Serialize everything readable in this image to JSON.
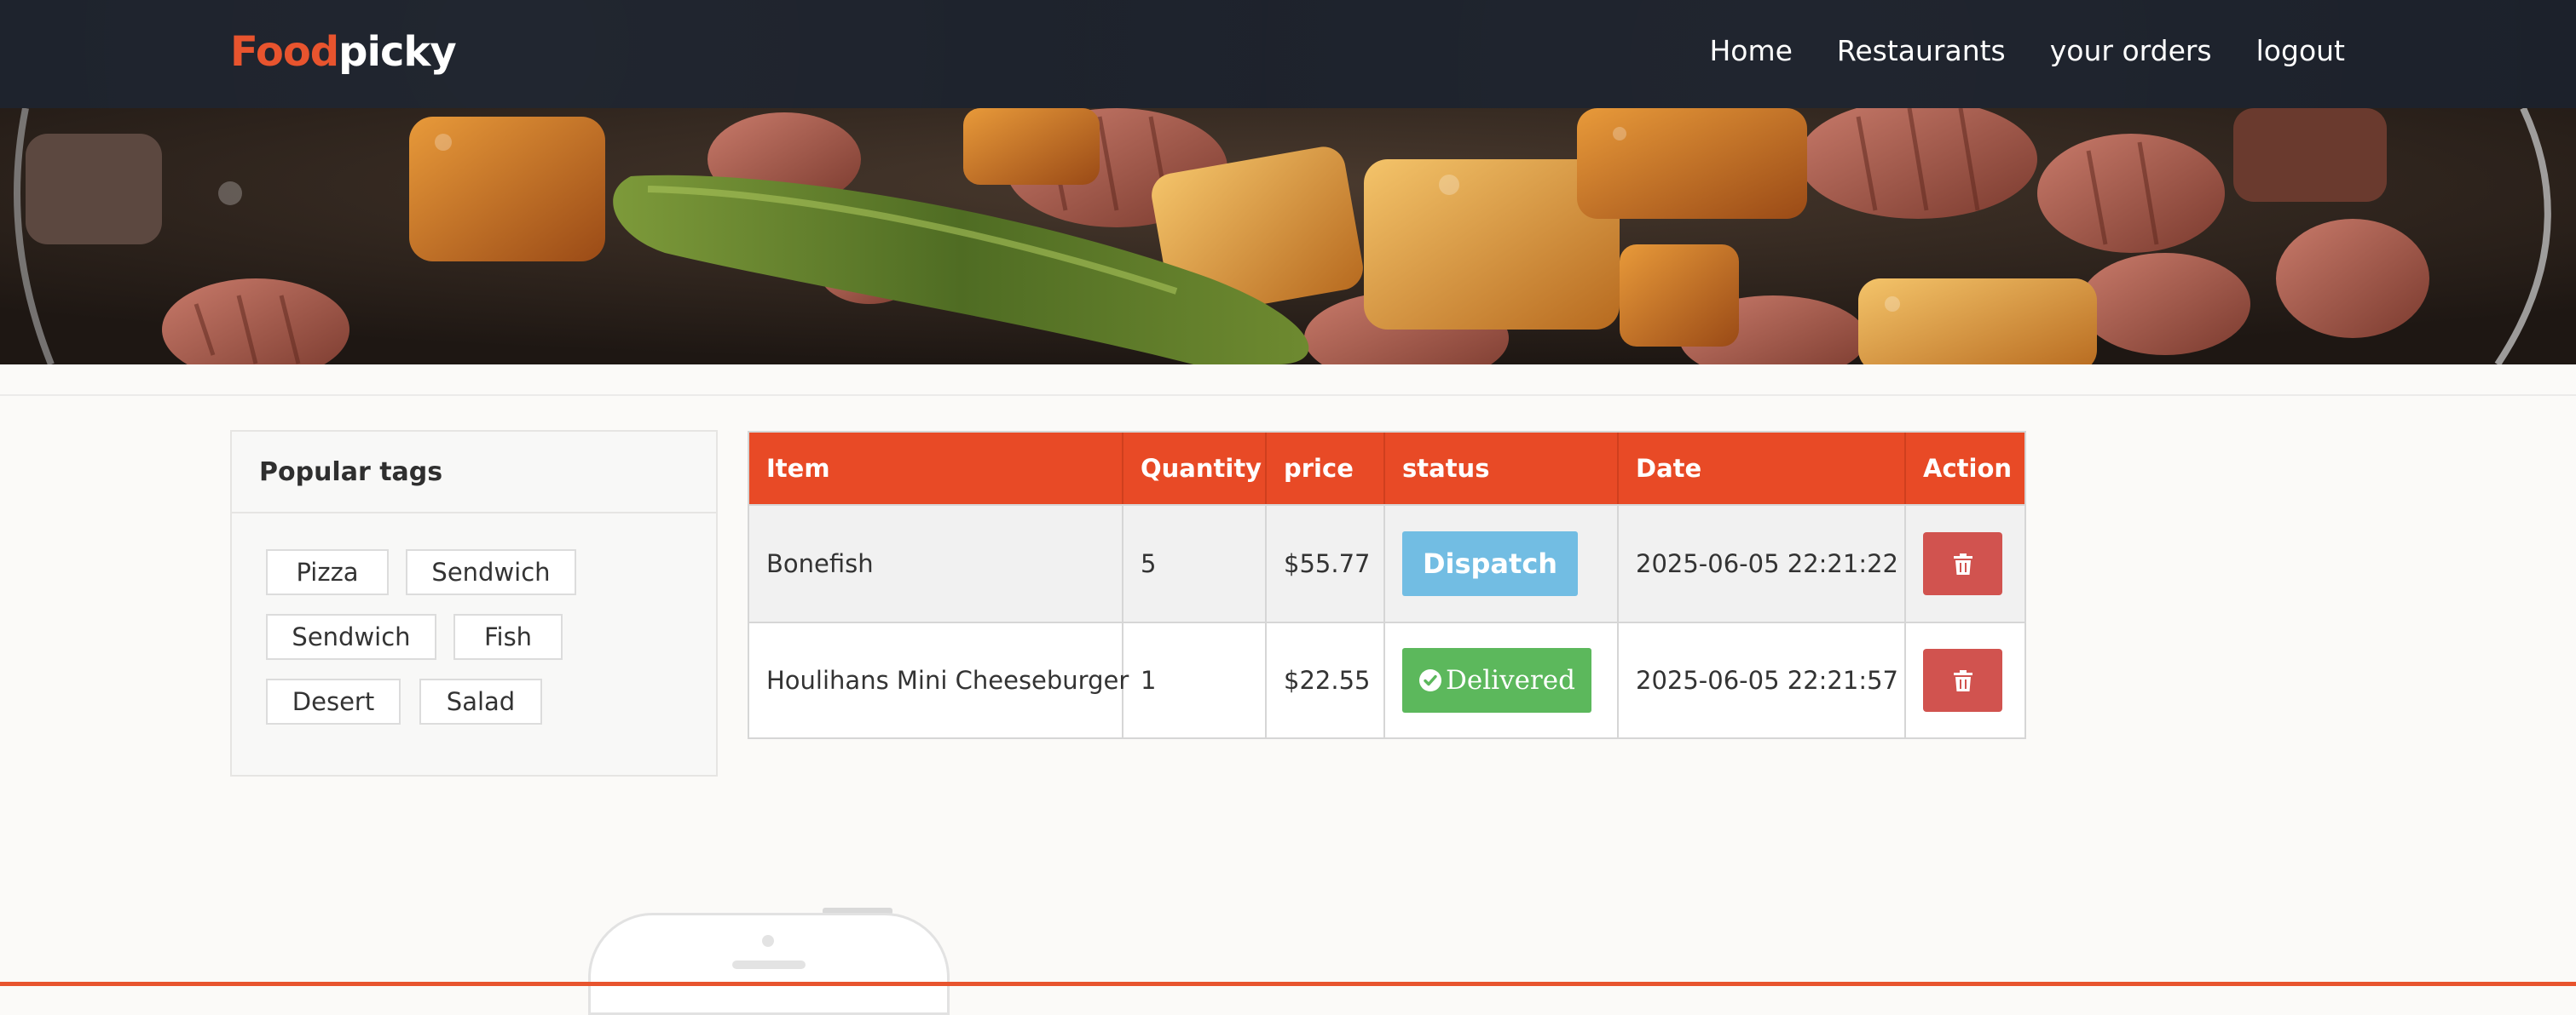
{
  "brand": {
    "logo_part1": "Food",
    "logo_part2": "picky",
    "accent_color": "#e8542e"
  },
  "nav": {
    "items": [
      {
        "label": "Home"
      },
      {
        "label": "Restaurants"
      },
      {
        "label": "your orders"
      },
      {
        "label": "logout"
      }
    ]
  },
  "hero": {
    "image": "food-hero-photo"
  },
  "sidebar": {
    "title": "Popular tags",
    "tags": [
      "Pizza",
      "Sendwich",
      "Sendwich",
      "Fish",
      "Desert",
      "Salad"
    ]
  },
  "orders": {
    "headers": {
      "item": "Item",
      "quantity": "Quantity",
      "price": "price",
      "status": "status",
      "date": "Date",
      "action": "Action"
    },
    "rows": [
      {
        "item": "Bonefish",
        "quantity": "5",
        "price": "$55.77",
        "status": "Dispatch",
        "status_color": "#72bde3",
        "date": "2025-06-05 22:21:22",
        "action_icon": "trash-icon"
      },
      {
        "item": "Houlihans Mini Cheeseburger",
        "quantity": "1",
        "price": "$22.55",
        "status": "Delivered",
        "status_icon": "check-circle-icon",
        "status_color": "#5cb85c",
        "date": "2025-06-05 22:21:57",
        "action_icon": "trash-icon"
      }
    ],
    "header_color": "#e84a26",
    "delete_color": "#d1534f"
  }
}
